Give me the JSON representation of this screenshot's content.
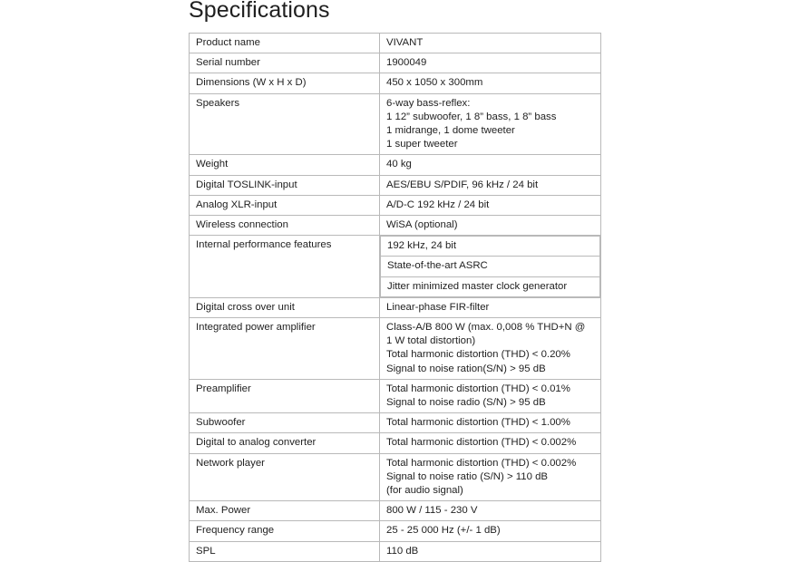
{
  "document": {
    "title": "Specifications"
  },
  "table": {
    "rows": [
      {
        "label": "Product name",
        "value_lines": [
          "VIVANT"
        ]
      },
      {
        "label": "Serial number",
        "value_lines": [
          "1900049"
        ]
      },
      {
        "label": "Dimensions (W x H x D)",
        "value_lines": [
          "450 x 1050 x 300mm"
        ]
      },
      {
        "label": "Speakers",
        "value_lines": [
          "6-way bass-reflex:",
          "1 12” subwoofer, 1 8” bass, 1 8” bass",
          "1 midrange, 1 dome tweeter",
          "1 super tweeter"
        ]
      },
      {
        "label": "Weight",
        "value_lines": [
          "40 kg"
        ]
      },
      {
        "label": "Digital TOSLINK-input",
        "value_lines": [
          "AES/EBU S/PDIF, 96 kHz / 24 bit"
        ]
      },
      {
        "label": "Analog XLR-input",
        "value_lines": [
          "A/D-C 192 kHz / 24 bit"
        ]
      },
      {
        "label": "Wireless connection",
        "value_lines": [
          "WiSA (optional)"
        ]
      },
      {
        "label": "Internal performance features",
        "sub_values": [
          "192 kHz, 24 bit",
          "State-of-the-art ASRC",
          "Jitter minimized master clock generator"
        ]
      },
      {
        "label": "Digital cross over unit",
        "value_lines": [
          "Linear-phase FIR-filter"
        ]
      },
      {
        "label": "Integrated power amplifier",
        "value_lines": [
          "Class-A/B 800 W (max. 0,008 % THD+N @",
          "1 W total distortion)",
          "Total harmonic distortion (THD) < 0.20%",
          "Signal to noise ration(S/N) > 95 dB"
        ]
      },
      {
        "label": "Preamplifier",
        "value_lines": [
          "Total harmonic distortion (THD) < 0.01%",
          "Signal to noise radio (S/N) > 95 dB"
        ]
      },
      {
        "label": "Subwoofer",
        "value_lines": [
          "Total harmonic distortion (THD) < 1.00%"
        ]
      },
      {
        "label": "Digital to analog converter",
        "value_lines": [
          "Total harmonic distortion (THD) < 0.002%"
        ]
      },
      {
        "label": "Network player",
        "value_lines": [
          "Total harmonic distortion (THD) < 0.002%",
          "Signal to noise ratio (S/N) > 110 dB",
          "(for audio signal)"
        ]
      },
      {
        "label": "Max. Power",
        "value_lines": [
          "800 W / 115 - 230 V"
        ]
      },
      {
        "label": "Frequency range",
        "value_lines": [
          "25 - 25 000 Hz (+/- 1 dB)"
        ]
      },
      {
        "label": "SPL",
        "value_lines": [
          "110 dB"
        ]
      }
    ]
  },
  "colors": {
    "text": "#222222",
    "border": "#b9b9b9",
    "background": "#ffffff"
  }
}
